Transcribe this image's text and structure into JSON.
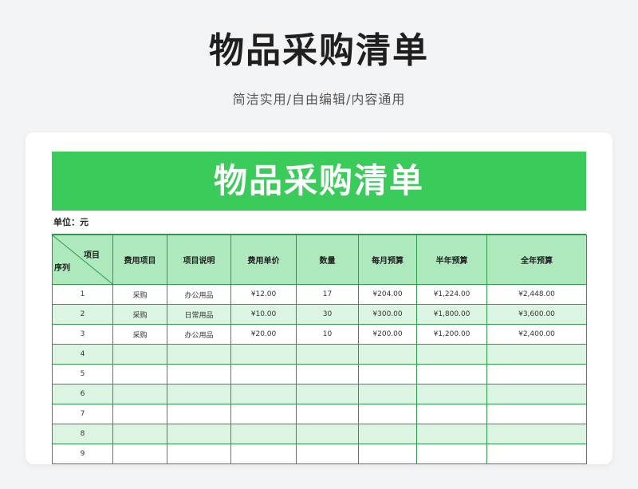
{
  "page": {
    "title": "物品采购清单",
    "subtitle": "简洁实用/自由编辑/内容通用"
  },
  "sheet": {
    "banner": "物品采购清单",
    "unit_label": "单位：元",
    "diag_header": {
      "top": "项目",
      "bottom": "序列"
    },
    "headers": [
      "费用项目",
      "项目说明",
      "费用单价",
      "数量",
      "每月预算",
      "半年预算",
      "全年预算"
    ],
    "rows": [
      [
        "1",
        "采购",
        "办公用品",
        "¥12.00",
        "17",
        "¥204.00",
        "¥1,224.00",
        "¥2,448.00"
      ],
      [
        "2",
        "采购",
        "日常用品",
        "¥10.00",
        "30",
        "¥300.00",
        "¥1,800.00",
        "¥3,600.00"
      ],
      [
        "3",
        "采购",
        "办公用品",
        "¥20.00",
        "10",
        "¥200.00",
        "¥1,200.00",
        "¥2,400.00"
      ],
      [
        "4",
        "",
        "",
        "",
        "",
        "",
        "",
        ""
      ],
      [
        "5",
        "",
        "",
        "",
        "",
        "",
        "",
        ""
      ],
      [
        "6",
        "",
        "",
        "",
        "",
        "",
        "",
        ""
      ],
      [
        "7",
        "",
        "",
        "",
        "",
        "",
        "",
        ""
      ],
      [
        "8",
        "",
        "",
        "",
        "",
        "",
        "",
        ""
      ],
      [
        "9",
        "",
        "",
        "",
        "",
        "",
        "",
        ""
      ]
    ],
    "colors": {
      "banner_bg": "#3acb5a",
      "header_bg": "#aee8bd",
      "stripe_bg": "#dcf5e2",
      "border": "#2c9a47"
    }
  }
}
